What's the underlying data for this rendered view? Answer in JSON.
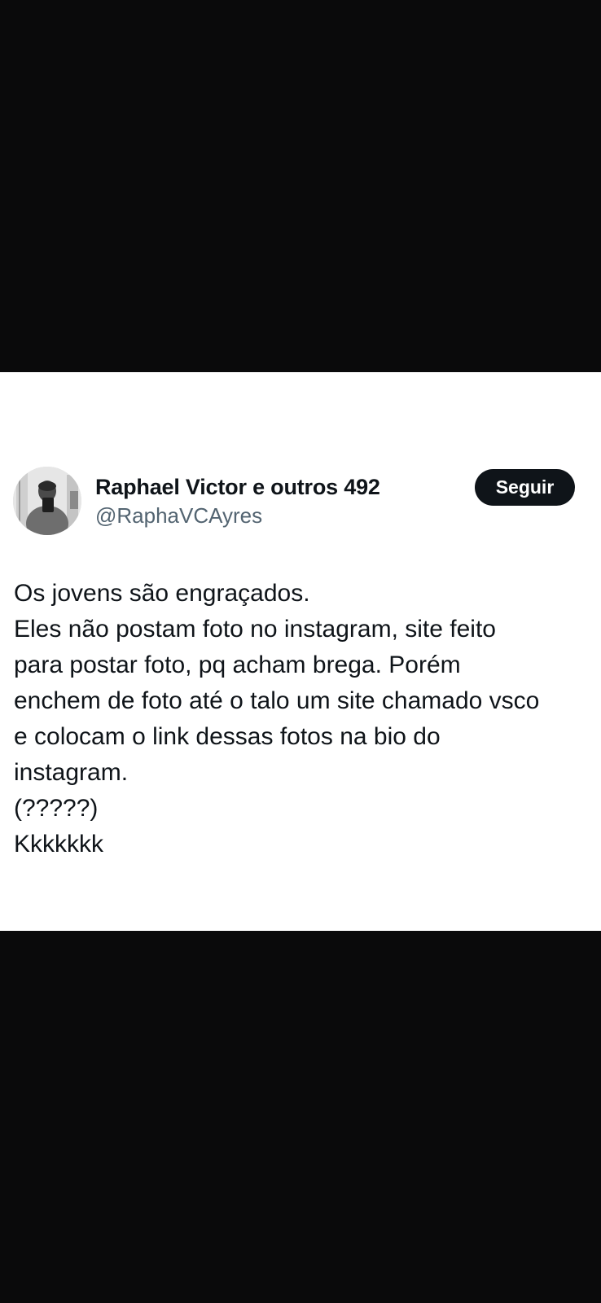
{
  "tweet": {
    "author": {
      "display_name": "Raphael Victor e outros 492",
      "handle": "@RaphaVCAyres",
      "avatar_icon": "profile-photo"
    },
    "follow_button": {
      "label": "Seguir"
    },
    "text_lines": [
      "Os jovens são engraçados.",
      "Eles não postam foto no instagram, site feito",
      "para postar foto, pq acham brega. Porém",
      "enchem de foto até o talo um site chamado vsco",
      "e colocam o link dessas fotos na bio do",
      "instagram.",
      "(?????)",
      "Kkkkkkk"
    ]
  },
  "colors": {
    "background": "#0a0a0b",
    "card": "#ffffff",
    "text_primary": "#0f1419",
    "text_secondary": "#536471",
    "button_bg": "#0f1419",
    "button_text": "#ffffff"
  }
}
